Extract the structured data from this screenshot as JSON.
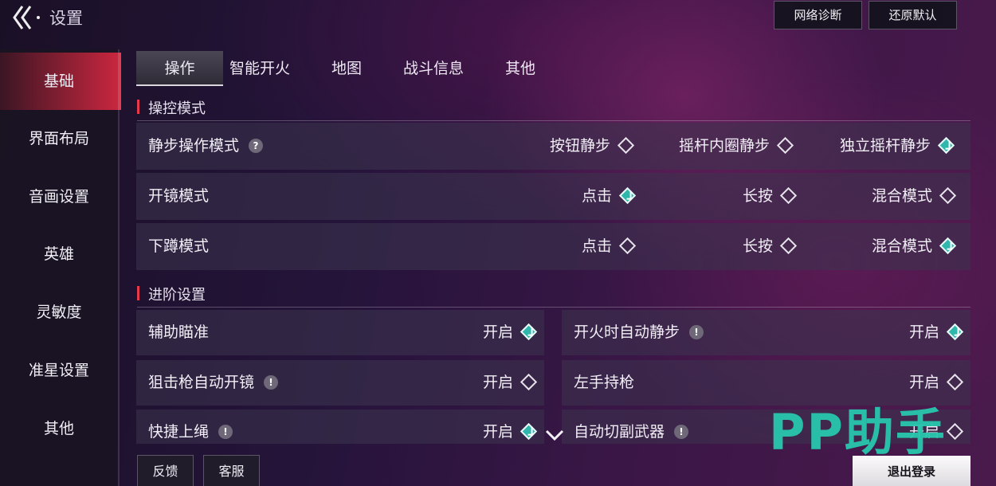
{
  "header": {
    "title": "设置",
    "buttons": [
      "网络诊断",
      "还原默认"
    ]
  },
  "sidebar": {
    "items": [
      {
        "label": "基础",
        "active": true
      },
      {
        "label": "界面布局",
        "active": false
      },
      {
        "label": "音画设置",
        "active": false
      },
      {
        "label": "英雄",
        "active": false
      },
      {
        "label": "灵敏度",
        "active": false
      },
      {
        "label": "准星设置",
        "active": false
      },
      {
        "label": "其他",
        "active": false
      }
    ]
  },
  "tabs": [
    {
      "label": "操作",
      "active": true
    },
    {
      "label": "智能开火",
      "active": false
    },
    {
      "label": "地图",
      "active": false
    },
    {
      "label": "战斗信息",
      "active": false
    },
    {
      "label": "其他",
      "active": false
    }
  ],
  "control_mode": {
    "section_title": "操控模式",
    "rows": [
      {
        "label": "静步操作模式",
        "help": "?",
        "options": [
          {
            "label": "按钮静步",
            "selected": false
          },
          {
            "label": "摇杆内圈静步",
            "selected": false
          },
          {
            "label": "独立摇杆静步",
            "selected": true
          }
        ]
      },
      {
        "label": "开镜模式",
        "options": [
          {
            "label": "点击",
            "selected": true
          },
          {
            "label": "长按",
            "selected": false
          },
          {
            "label": "混合模式",
            "selected": false
          }
        ]
      },
      {
        "label": "下蹲模式",
        "options": [
          {
            "label": "点击",
            "selected": false
          },
          {
            "label": "长按",
            "selected": false
          },
          {
            "label": "混合模式",
            "selected": true
          }
        ]
      }
    ]
  },
  "advanced": {
    "section_title": "进阶设置",
    "items": [
      {
        "label": "辅助瞄准",
        "info": "",
        "toggle_label": "开启",
        "on": true
      },
      {
        "label": "开火时自动静步",
        "info": "!",
        "toggle_label": "开启",
        "on": true
      },
      {
        "label": "狙击枪自动开镜",
        "info": "!",
        "toggle_label": "开启",
        "on": false
      },
      {
        "label": "左手持枪",
        "info": "",
        "toggle_label": "开启",
        "on": false
      },
      {
        "label": "快捷上绳",
        "info": "!",
        "toggle_label": "开启",
        "on": true
      },
      {
        "label": "自动切副武器",
        "info": "!",
        "toggle_label": "开启",
        "on": false
      }
    ]
  },
  "footer": {
    "feedback": "反馈",
    "service": "客服",
    "logout": "退出登录"
  },
  "watermark": "PP助手",
  "colors": {
    "accent": "#e43a4b",
    "selected": "#2fb6ad",
    "active_tab": "#4a4654"
  }
}
